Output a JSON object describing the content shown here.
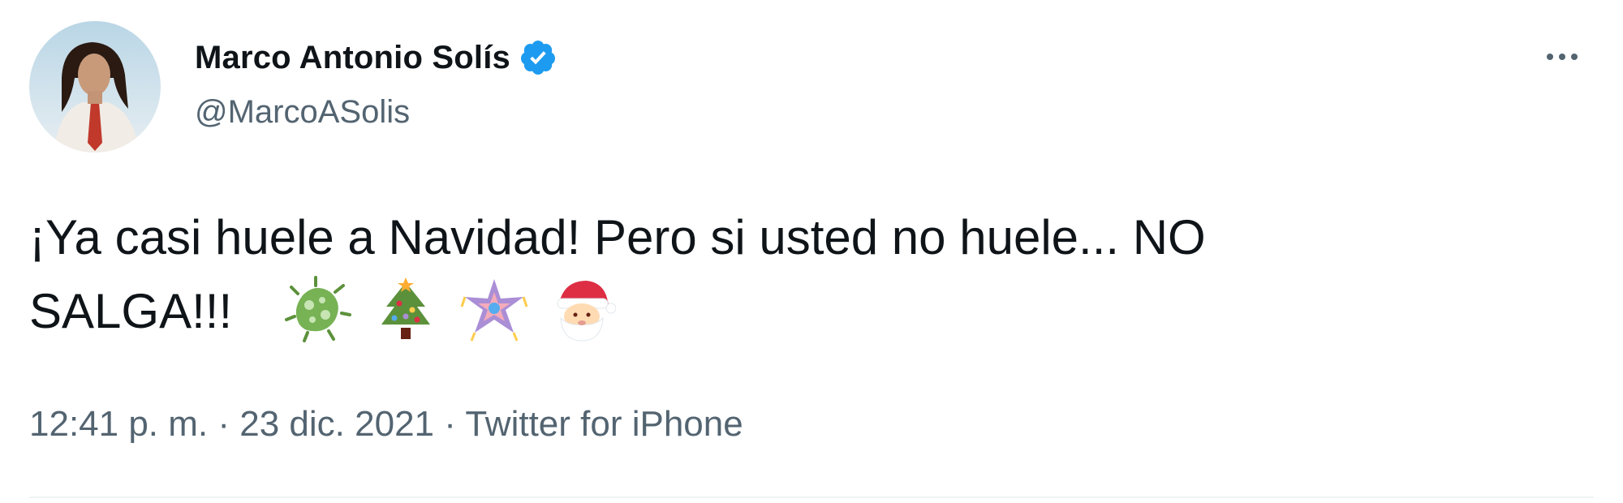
{
  "author": {
    "display_name": "Marco Antonio Solís",
    "handle": "@MarcoASolis",
    "verified": true
  },
  "tweet": {
    "text_line1": "¡Ya casi huele a Navidad! Pero si usted no huele... NO",
    "text_line2": "SALGA!!!",
    "emojis": [
      "microbe",
      "christmas-tree",
      "pinata",
      "santa-claus"
    ]
  },
  "meta": {
    "time": "12:41 p. m.",
    "separator": "·",
    "date": "23 dic. 2021",
    "source": "Twitter for iPhone"
  },
  "colors": {
    "verified_blue": "#1d9bf0",
    "secondary_text": "#536471",
    "primary_text": "#0f1419"
  },
  "icons": {
    "more": "more-horizontal-icon",
    "verified": "verified-badge-icon"
  }
}
